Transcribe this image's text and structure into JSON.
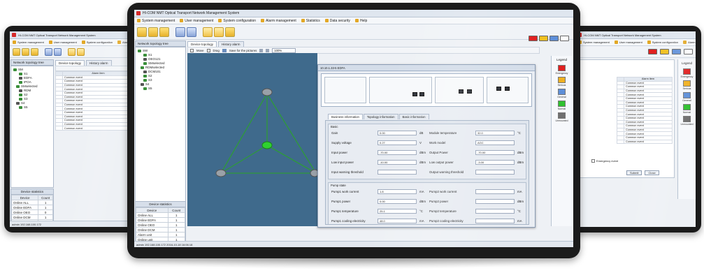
{
  "app": {
    "title": "HI-COM NMT Optical Transport Network Management System",
    "menu": [
      "System management",
      "User management",
      "System configuration",
      "Alarm management",
      "Statistics",
      "Data security",
      "Help"
    ]
  },
  "colors": {
    "emergency": "#e02020",
    "serious": "#f0b020",
    "general": "#5e8fd8",
    "normal": "#2fc12f",
    "unmounted": "#707070"
  },
  "left_screen": {
    "tree_title": "Network topology tree",
    "tabs": [
      "Device topology",
      "History alarm"
    ],
    "tree": [
      "SM",
      "S1",
      "EDFA",
      "IPOA",
      "SMselected",
      "RDM",
      "S2",
      "S3",
      "S4",
      "S5"
    ],
    "table_header": [
      "",
      "Alarm item"
    ],
    "table_rows": [
      "Common event",
      "Common event",
      "Common event",
      "Common event",
      "Common event",
      "Common event",
      "Common event",
      "Common event",
      "Common event",
      "Common event",
      "Common event",
      "Common event",
      "Common event",
      "Common event"
    ],
    "stats_title": "Device statistics",
    "stats_head": [
      "Device",
      "Count"
    ],
    "stats_rows": [
      [
        "Online ALL",
        "1"
      ],
      [
        "Online EDFA",
        "1"
      ],
      [
        "Online OEO",
        "0"
      ],
      [
        "Online DCM",
        "1"
      ],
      [
        "Alarm unit",
        "0"
      ],
      [
        "Online unit",
        "1"
      ]
    ],
    "footer": "admin   192.168.100.172"
  },
  "center_screen": {
    "tree_title": "Network topology tree",
    "tabs": [
      "Device topology",
      "History alarm"
    ],
    "tree": [
      "SW",
      "S1",
      "OEO121",
      "SMselected",
      "RDMselected",
      "DCM101",
      "S2",
      "S3",
      "S4",
      "S5"
    ],
    "view_toolbar": {
      "move": "Move",
      "drag": "Drag",
      "save": "Save for the pictures",
      "zoom": "100%"
    },
    "stats_title": "Device statistics",
    "stats_head": [
      "Device",
      "Count"
    ],
    "stats_rows": [
      [
        "Online ALL",
        "1"
      ],
      [
        "Online EDFA",
        "1"
      ],
      [
        "Online OEO",
        "1"
      ],
      [
        "Online DCM",
        "1"
      ],
      [
        "Alarm unit",
        "1"
      ],
      [
        "Online unit",
        "1"
      ]
    ],
    "footer": "admin   192.168.100.172    2016-10-18 16:06:18",
    "legend_title": "Legend",
    "legend": [
      "Emergency",
      "Serious",
      "General",
      "Normal",
      "Unmounted"
    ]
  },
  "dialog": {
    "title": "10.10.1.33-5 EDFA",
    "tabs": [
      "Business information",
      "Topology information",
      "Basic information"
    ],
    "basic_group": "Basic",
    "fields_left": [
      {
        "label": "Gain",
        "value": "0.00",
        "unit": "dB"
      },
      {
        "label": "Supply voltage",
        "value": "0.27",
        "unit": "V"
      },
      {
        "label": "Input power",
        "value": "-70.00",
        "unit": "dBm"
      },
      {
        "label": "Low input power",
        "value": "-10.00",
        "unit": "dBm"
      },
      {
        "label": "Input warning threshold",
        "value": "",
        "unit": ""
      }
    ],
    "fields_right": [
      {
        "label": "Module temperature",
        "value": "32.0",
        "unit": "°C"
      },
      {
        "label": "Work model",
        "value": "AGC",
        "unit": ""
      },
      {
        "label": "Output Power",
        "value": "-70.00",
        "unit": "dBm"
      },
      {
        "label": "Low output power",
        "value": "-3.00",
        "unit": "dBm"
      },
      {
        "label": "Output warning threshold",
        "value": "",
        "unit": ""
      }
    ],
    "pump_group": "Pump state",
    "pump_left": [
      {
        "label": "Pump1 work current",
        "value": "1.8",
        "unit": "mA"
      },
      {
        "label": "Pump1 power",
        "value": "0.00",
        "unit": "dBm"
      },
      {
        "label": "Pump1 temperature",
        "value": "25.1",
        "unit": "°C"
      },
      {
        "label": "Pump1 cooling electricity",
        "value": "48.0",
        "unit": "mA"
      }
    ],
    "pump_right": [
      {
        "label": "Pump2 work current",
        "value": "",
        "unit": "mA"
      },
      {
        "label": "Pump2 power",
        "value": "",
        "unit": "dBm"
      },
      {
        "label": "Pump2 temperature",
        "value": "",
        "unit": "°C"
      },
      {
        "label": "Pump2 cooling electricity",
        "value": "",
        "unit": "mA"
      }
    ]
  },
  "right_screen": {
    "legend_title": "Legend",
    "legend": [
      "Emergency",
      "Serious",
      "General",
      "Normal",
      "Unmounted"
    ],
    "table_header": [
      "",
      "Alarm item"
    ],
    "table_rows": [
      "Common event",
      "Common event",
      "Common event",
      "Common event",
      "Common event",
      "Common event",
      "Common event",
      "Common event",
      "Common event",
      "Common event",
      "Common event",
      "Common event",
      "Common event",
      "Common event",
      "Common event",
      "Common event"
    ],
    "checkbox": "Emergency event",
    "buttons": [
      "Submit",
      "Close"
    ]
  }
}
